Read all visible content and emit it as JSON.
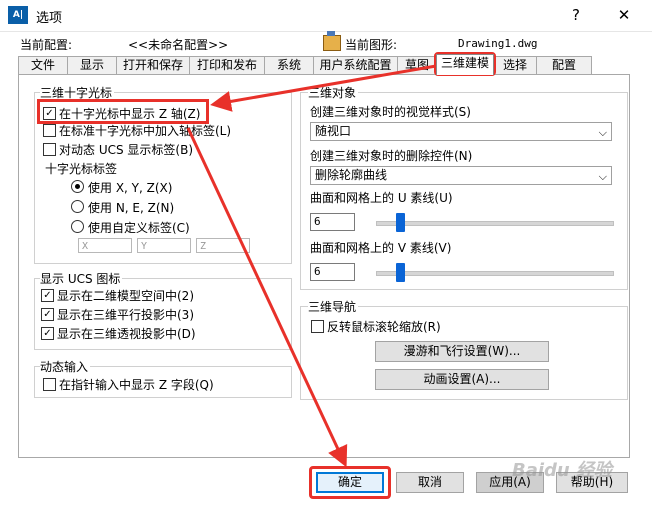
{
  "window": {
    "icon_text": "A|",
    "title": "选项",
    "help": "?",
    "close": "✕"
  },
  "info": {
    "profile_label": "当前配置:",
    "profile_value": "<<未命名配置>>",
    "drawing_label": "当前图形:",
    "drawing_value": "Drawing1.dwg"
  },
  "tabs": [
    {
      "label": "文件"
    },
    {
      "label": "显示"
    },
    {
      "label": "打开和保存"
    },
    {
      "label": "打印和发布"
    },
    {
      "label": "系统"
    },
    {
      "label": "用户系统配置"
    },
    {
      "label": "草图"
    },
    {
      "label": "三维建模",
      "active": true
    },
    {
      "label": "选择"
    },
    {
      "label": "配置"
    }
  ],
  "crosshair": {
    "group_title": "三维十字光标",
    "show_z": {
      "label": "在十字光标中显示 Z 轴(Z)",
      "checked": true
    },
    "axis_labels": {
      "label": "在标准十字光标中加入轴标签(L)",
      "checked": false
    },
    "ucs_labels": {
      "label": "对动态 UCS 显示标签(B)",
      "checked": false
    },
    "label_title": "十字光标标签",
    "radio_xyz": {
      "label": "使用 X, Y, Z(X)",
      "selected": true
    },
    "radio_nez": {
      "label": "使用 N, E, Z(N)",
      "selected": false
    },
    "radio_custom": {
      "label": "使用自定义标签(C)",
      "selected": false
    },
    "custom_x": "X",
    "custom_y": "Y",
    "custom_z": "Z"
  },
  "ucs_icon": {
    "group_title": "显示 UCS 图标",
    "model_2d": {
      "label": "显示在二维模型空间中(2)",
      "checked": true
    },
    "parallel_3d": {
      "label": "显示在三维平行投影中(3)",
      "checked": true
    },
    "perspective_3d": {
      "label": "显示在三维透视投影中(D)",
      "checked": true
    }
  },
  "dynamic_input": {
    "group_title": "动态输入",
    "show_z_field": {
      "label": "在指针输入中显示 Z 字段(Q)",
      "checked": false
    }
  },
  "objects_3d": {
    "group_title": "三维对象",
    "visual_style_label": "创建三维对象时的视觉样式(S)",
    "visual_style_value": "随视口",
    "deletion_label": "创建三维对象时的删除控件(N)",
    "deletion_value": "删除轮廓曲线",
    "u_label": "曲面和网格上的 U 素线(U)",
    "u_value": "6",
    "u_level": 0.1,
    "v_label": "曲面和网格上的 V 素线(V)",
    "v_value": "6",
    "v_level": 0.1
  },
  "navigation_3d": {
    "group_title": "三维导航",
    "reverse_wheel": {
      "label": "反转鼠标滚轮缩放(R)",
      "checked": false
    },
    "walk_fly_btn": "漫游和飞行设置(W)...",
    "animation_btn": "动画设置(A)..."
  },
  "footer": {
    "ok": "确定",
    "cancel": "取消",
    "apply": "应用(A)",
    "help": "帮助(H)"
  },
  "watermark": "Baidu 经验",
  "colors": {
    "annotation": "#e8312a",
    "slider": "#0a64d6",
    "default_button": "#0078d7"
  }
}
